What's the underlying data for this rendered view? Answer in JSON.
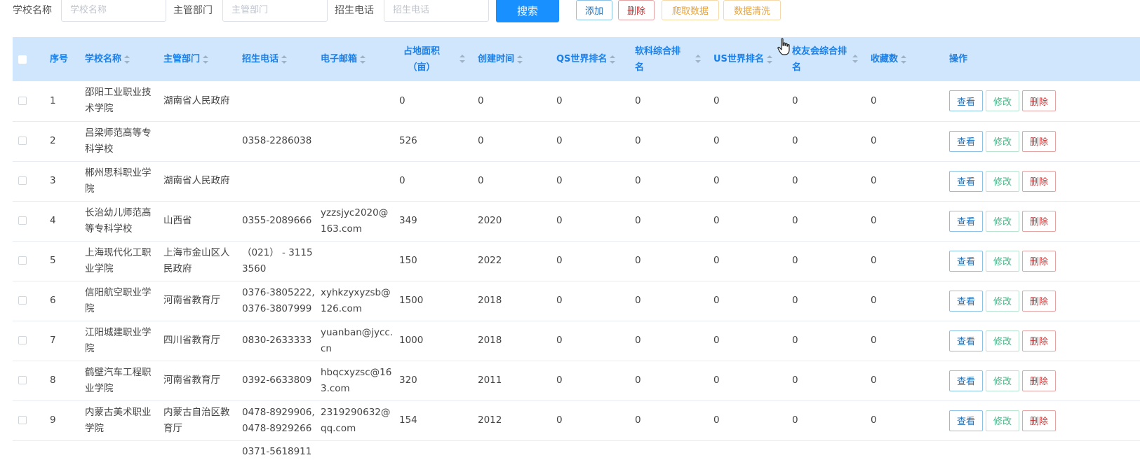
{
  "toolbar": {
    "school_label": "学校名称",
    "school_placeholder": "学校名称",
    "dept_label": "主管部门",
    "dept_placeholder": "主管部门",
    "phone_label": "招生电话",
    "phone_placeholder": "招生电话",
    "search": "搜索",
    "add": "添加",
    "delete": "删除",
    "crawl": "爬取数据",
    "clean": "数据清洗"
  },
  "colors": {
    "primary": "#1890ff",
    "header_bg": "#cfe6fc",
    "danger": "#cc2f2f",
    "warning": "#e6a23c",
    "success": "#4ab486"
  },
  "table": {
    "headers": [
      "序号",
      "学校名称",
      "主管部门",
      "招生电话",
      "电子邮箱",
      "占地面积（亩）",
      "创建时间",
      "QS世界排名",
      "软科综合排名",
      "US世界排名",
      "校友会综合排名",
      "收藏数",
      "操作"
    ],
    "actions": {
      "view": "查看",
      "edit": "修改",
      "delete": "删除"
    },
    "rows": [
      {
        "no": "1",
        "name": "邵阳工业职业技术学院",
        "dept": "湖南省人民政府",
        "phone": "",
        "email": "",
        "area": "0",
        "founded": "0",
        "qs": "0",
        "rk": "0",
        "us": "0",
        "xyh": "0",
        "fav": "0"
      },
      {
        "no": "2",
        "name": "吕梁师范高等专科学校",
        "dept": "",
        "phone": "0358-2286038",
        "email": "",
        "area": "526",
        "founded": "0",
        "qs": "0",
        "rk": "0",
        "us": "0",
        "xyh": "0",
        "fav": "0"
      },
      {
        "no": "3",
        "name": "郴州思科职业学院",
        "dept": "湖南省人民政府",
        "phone": "",
        "email": "",
        "area": "0",
        "founded": "0",
        "qs": "0",
        "rk": "0",
        "us": "0",
        "xyh": "0",
        "fav": "0"
      },
      {
        "no": "4",
        "name": "长治幼儿师范高等专科学校",
        "dept": "山西省",
        "phone": "0355-2089666",
        "email": "yzzsjyc2020@163.com",
        "area": "349",
        "founded": "2020",
        "qs": "0",
        "rk": "0",
        "us": "0",
        "xyh": "0",
        "fav": "0"
      },
      {
        "no": "5",
        "name": "上海现代化工职业学院",
        "dept": "上海市金山区人民政府",
        "phone": "（021） - 31153560",
        "email": "",
        "area": "150",
        "founded": "2022",
        "qs": "0",
        "rk": "0",
        "us": "0",
        "xyh": "0",
        "fav": "0"
      },
      {
        "no": "6",
        "name": "信阳航空职业学院",
        "dept": "河南省教育厅",
        "phone": "0376-3805222,0376-3807999",
        "email": "xyhkzyxyzsb@126.com",
        "area": "1500",
        "founded": "2018",
        "qs": "0",
        "rk": "0",
        "us": "0",
        "xyh": "0",
        "fav": "0"
      },
      {
        "no": "7",
        "name": "江阳城建职业学院",
        "dept": "四川省教育厅",
        "phone": "0830-2633333",
        "email": "yuanban@jycc.cn",
        "area": "1000",
        "founded": "2018",
        "qs": "0",
        "rk": "0",
        "us": "0",
        "xyh": "0",
        "fav": "0"
      },
      {
        "no": "8",
        "name": "鹤壁汽车工程职业学院",
        "dept": "河南省教育厅",
        "phone": "0392-6633809",
        "email": "hbqcxyzsc@163.com",
        "area": "320",
        "founded": "2011",
        "qs": "0",
        "rk": "0",
        "us": "0",
        "xyh": "0",
        "fav": "0"
      },
      {
        "no": "9",
        "name": "内蒙古美术职业学院",
        "dept": "内蒙古自治区教育厅",
        "phone": "0478-8929906,0478-8929266",
        "email": "2319290632@qq.com",
        "area": "154",
        "founded": "2012",
        "qs": "0",
        "rk": "0",
        "us": "0",
        "xyh": "0",
        "fav": "0"
      },
      {
        "no": "",
        "name": "",
        "dept": "",
        "phone": "0371-5618911",
        "email": "",
        "area": "",
        "founded": "",
        "qs": "",
        "rk": "",
        "us": "",
        "xyh": "",
        "fav": ""
      }
    ]
  }
}
